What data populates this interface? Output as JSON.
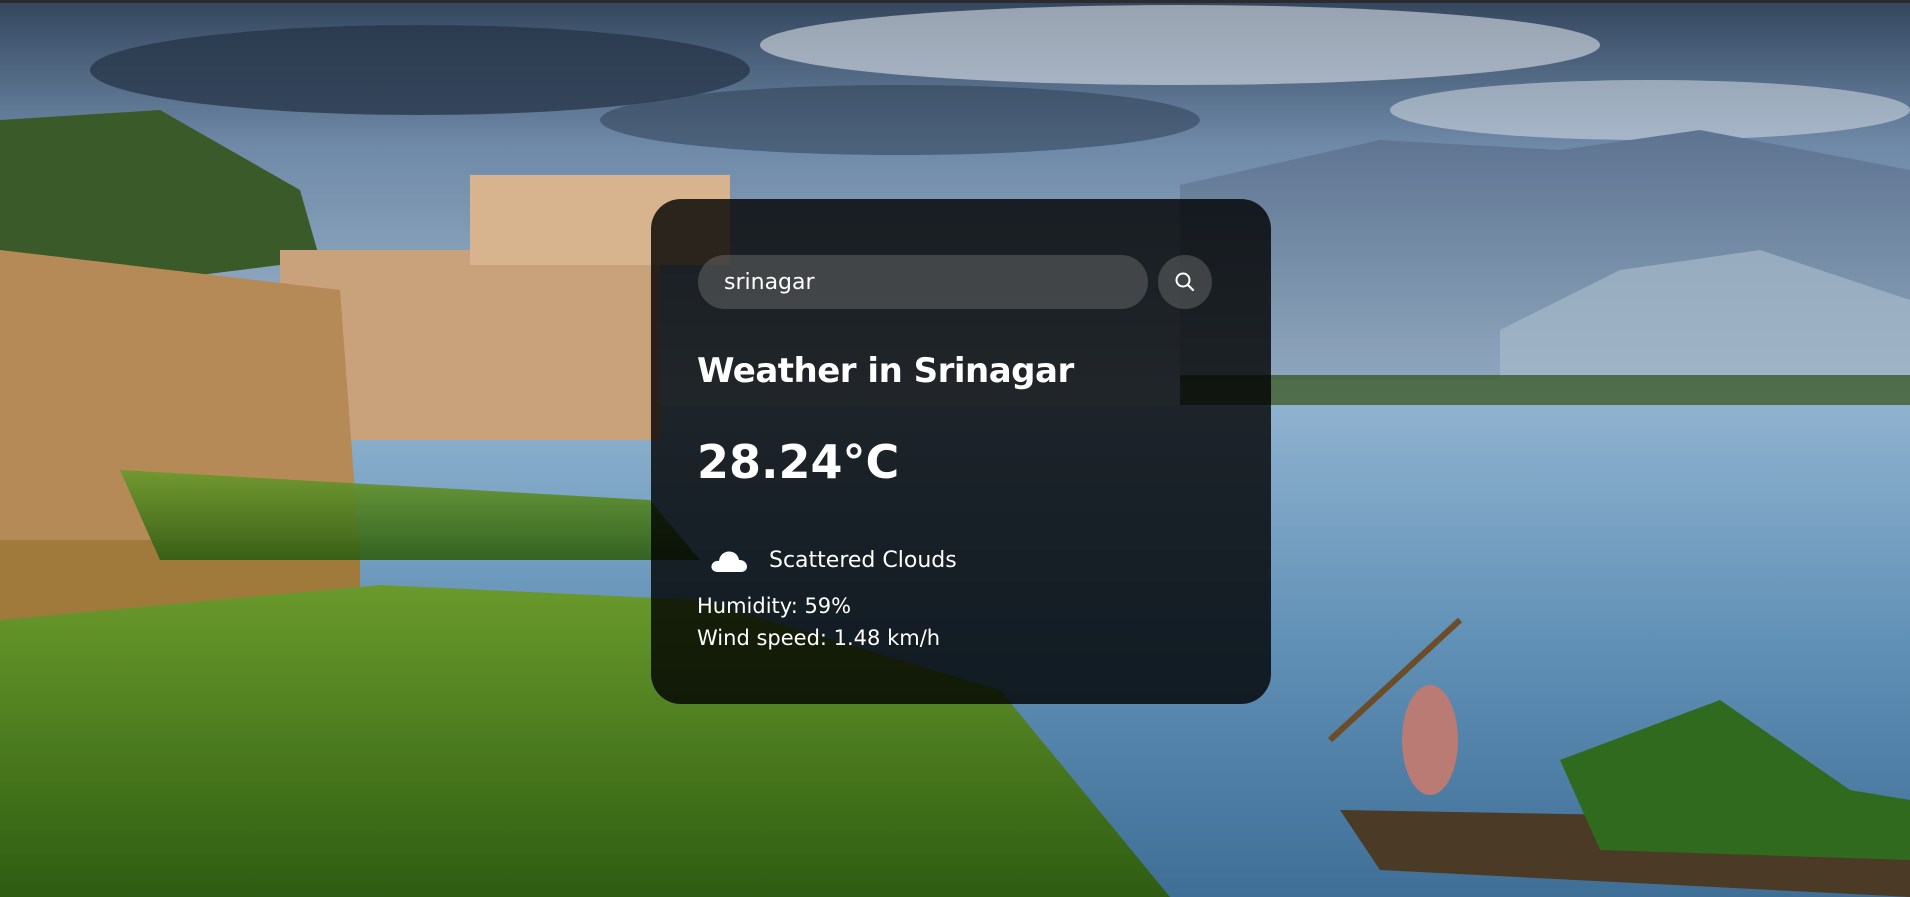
{
  "search": {
    "value": "srinagar",
    "icon": "search-icon"
  },
  "weather": {
    "title": "Weather in Srinagar",
    "temperature": "28.24°C",
    "description": "Scattered Clouds",
    "description_icon": "cloud-icon",
    "humidity": "Humidity: 59%",
    "wind": "Wind speed: 1.48 km/h"
  },
  "colors": {
    "card_background": "#000000",
    "text": "#ffffff",
    "search_field": "#7e7e7e"
  }
}
